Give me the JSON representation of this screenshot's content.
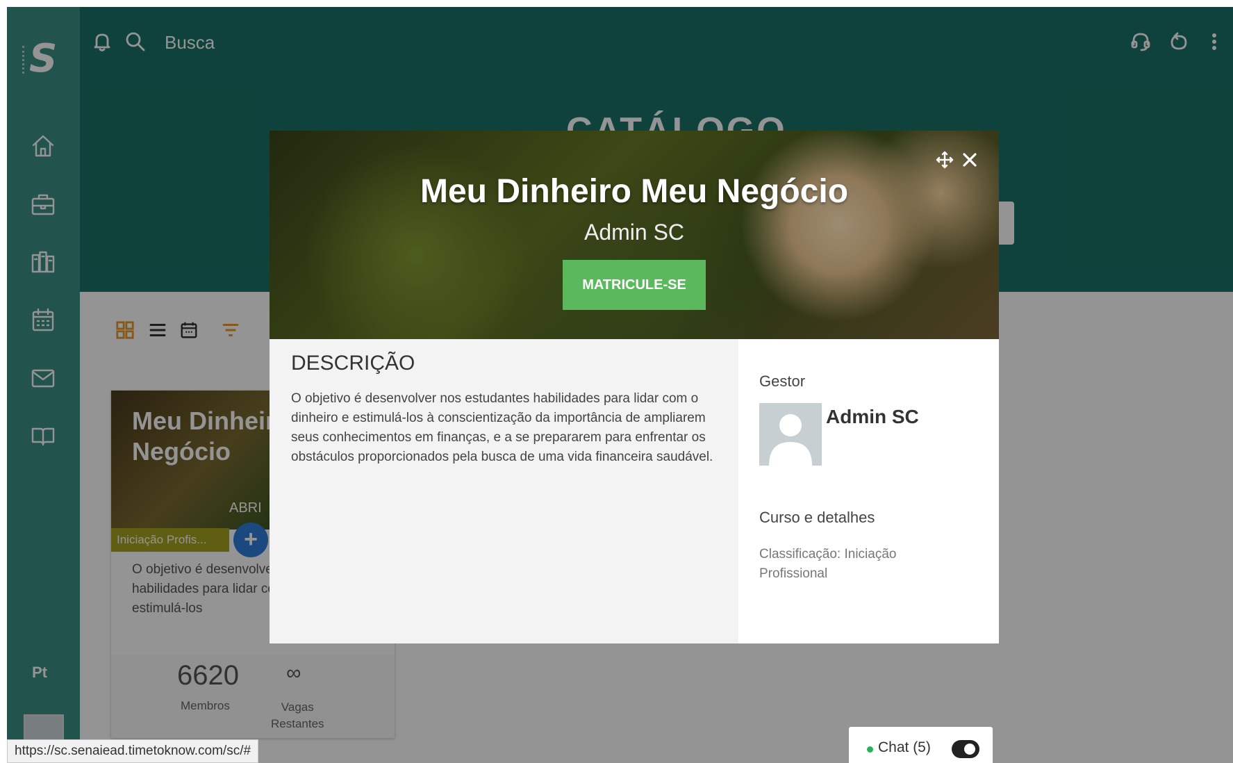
{
  "header": {
    "search_label": "Busca",
    "page_title": "CATÁLOGO"
  },
  "sidebar": {
    "logo_letter": "S",
    "language": "Pt",
    "items": [
      "home-icon",
      "briefcase-icon",
      "library-icon",
      "calendar-icon",
      "mail-icon",
      "book-icon"
    ]
  },
  "course_card": {
    "title": "Meu Dinheiro Meu Negócio",
    "status_partial": "ABRI",
    "tag": "Iniciação Profis...",
    "description": "O objetivo é desenvolver nos estudantes habilidades para lidar com o dinheiro e estimulá-los",
    "members_count": "6620",
    "members_label": "Membros",
    "vacancies_value": "∞",
    "vacancies_label_line1": "Vagas",
    "vacancies_label_line2": "Restantes"
  },
  "modal": {
    "title": "Meu Dinheiro Meu Negócio",
    "subtitle": "Admin SC",
    "enroll_label": "MATRICULE-SE",
    "description_heading": "DESCRIÇÃO",
    "description_text": "O objetivo é desenvolver nos estudantes habilidades para lidar com o dinheiro e estimulá-los à conscientização da importância de ampliarem seus conhecimentos em finanças, e a se prepararem para enfrentar os obstáculos proporcionados pela busca de uma vida financeira saudável.",
    "manager_label": "Gestor",
    "manager_name": "Admin SC",
    "details_label": "Curso e detalhes",
    "classification": "Classificação: Iniciação Profissional"
  },
  "chat": {
    "label": "Chat (5)"
  },
  "status_bar": {
    "url": "https://sc.senaiead.timetoknow.com/sc/#"
  },
  "colors": {
    "sidebar": "#3d8f86",
    "header": "#1b7268",
    "enroll_button": "#5cb85c",
    "tag": "#a6a21f",
    "plus_button": "#2f7ddb"
  }
}
